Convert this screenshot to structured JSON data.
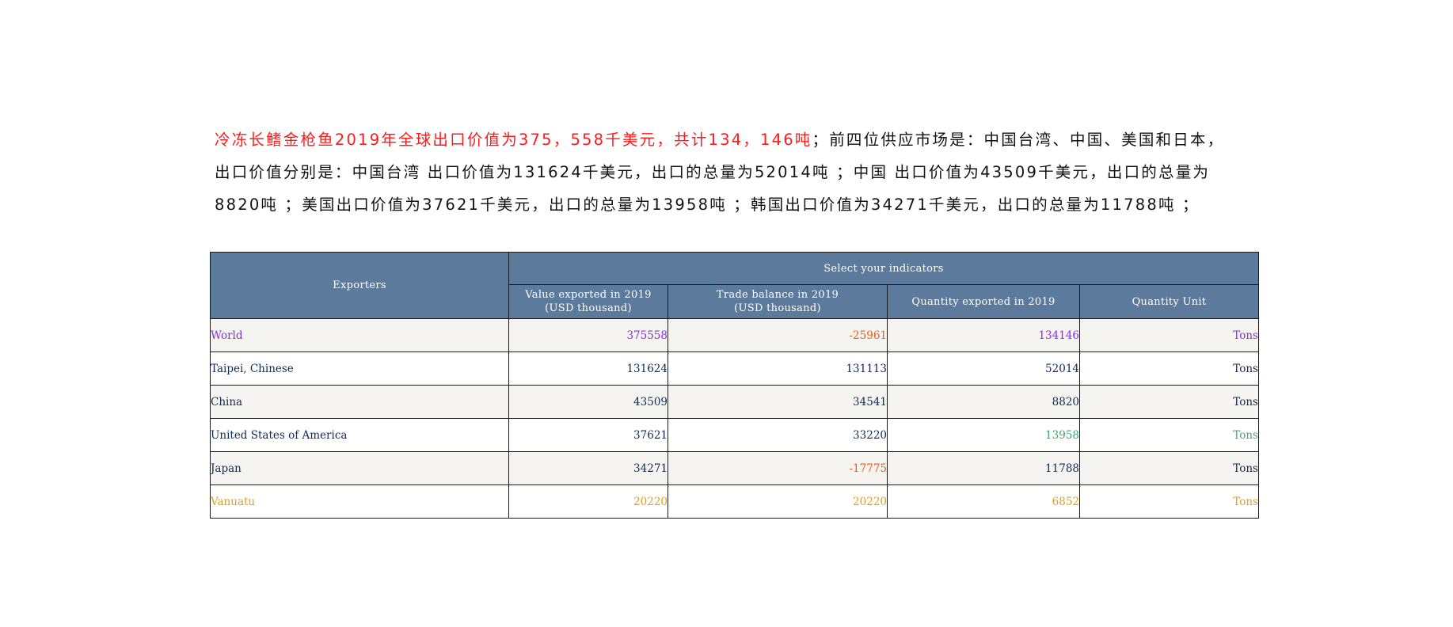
{
  "summary": {
    "highlight": "冷冻长鳍金枪鱼2019年全球出口价值为375，558千美元，共计134，146吨",
    "rest": "；前四位供应市场是：中国台湾、中国、美国和日本，出口价值分别是：中国台湾 出口价值为131624千美元，出口的总量为52014吨 ；中国 出口价值为43509千美元，出口的总量为8820吨 ；美国出口价值为37621千美元，出口的总量为13958吨 ；韩国出口价值为34271千美元，出口的总量为11788吨 ；",
    "highlight_color": "#ff1a1a"
  },
  "table": {
    "header": {
      "exporters": "Exporters",
      "group": "Select your indicators",
      "value_line1": "Value exported in 2019",
      "value_line2": "(USD thousand)",
      "trade_line1": "Trade balance in 2019",
      "trade_line2": "(USD thousand)",
      "quantity": "Quantity exported in 2019",
      "unit": "Quantity Unit"
    },
    "colors": {
      "default": "#0e2a55",
      "world": "#8a2be2",
      "negative": "#f05a14",
      "usa_highlight": "#3aaa6e",
      "vanuatu": "#dca021",
      "header_bg": "#5c7a9c"
    },
    "rows": [
      {
        "exporter": "World",
        "value": "375558",
        "trade": "-25961",
        "quantity": "134146",
        "unit": "Tons",
        "c_exporter": "#8a2be2",
        "c_value": "#8a2be2",
        "c_trade": "#f05a14",
        "c_quantity": "#8a2be2",
        "c_unit": "#8a2be2"
      },
      {
        "exporter": "Taipei, Chinese",
        "value": "131624",
        "trade": "131113",
        "quantity": "52014",
        "unit": "Tons",
        "c_exporter": "#0e2a55",
        "c_value": "#0e2a55",
        "c_trade": "#0e2a55",
        "c_quantity": "#0e2a55",
        "c_unit": "#0e2a55"
      },
      {
        "exporter": "China",
        "value": "43509",
        "trade": "34541",
        "quantity": "8820",
        "unit": "Tons",
        "c_exporter": "#0e2a55",
        "c_value": "#0e2a55",
        "c_trade": "#0e2a55",
        "c_quantity": "#0e2a55",
        "c_unit": "#0e2a55"
      },
      {
        "exporter": "United States of America",
        "value": "37621",
        "trade": "33220",
        "quantity": "13958",
        "unit": "Tons",
        "c_exporter": "#0e2a55",
        "c_value": "#0e2a55",
        "c_trade": "#0e2a55",
        "c_quantity": "#3aaa6e",
        "c_unit": "#3aaa6e"
      },
      {
        "exporter": "Japan",
        "value": "34271",
        "trade": "-17775",
        "quantity": "11788",
        "unit": "Tons",
        "c_exporter": "#0e2a55",
        "c_value": "#0e2a55",
        "c_trade": "#f05a14",
        "c_quantity": "#0e2a55",
        "c_unit": "#0e2a55"
      },
      {
        "exporter": "Vanuatu",
        "value": "20220",
        "trade": "20220",
        "quantity": "6852",
        "unit": "Tons",
        "c_exporter": "#dca021",
        "c_value": "#dca021",
        "c_trade": "#dca021",
        "c_quantity": "#dca021",
        "c_unit": "#dca021"
      }
    ]
  }
}
